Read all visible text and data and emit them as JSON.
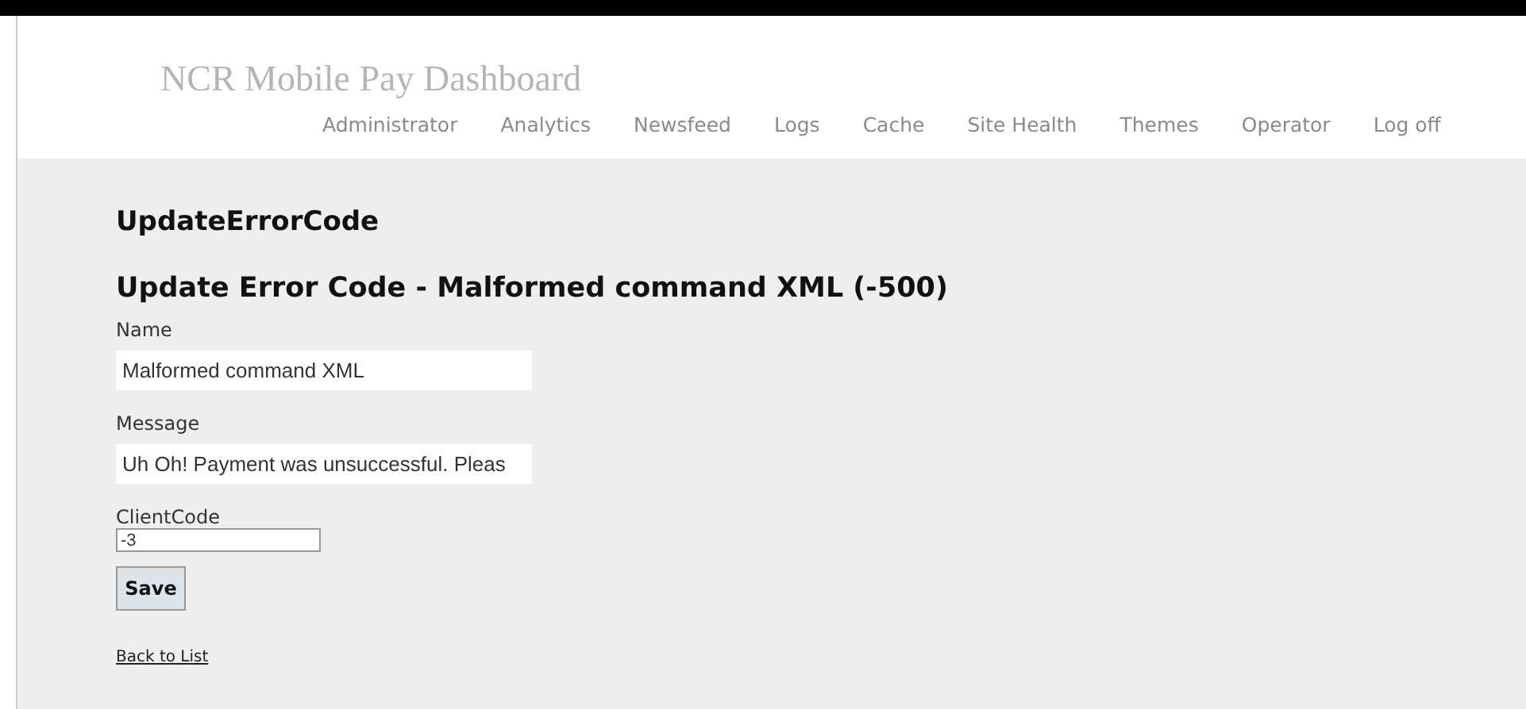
{
  "header": {
    "title": "NCR Mobile Pay Dashboard"
  },
  "nav": [
    {
      "label": "Administrator"
    },
    {
      "label": "Analytics"
    },
    {
      "label": "Newsfeed"
    },
    {
      "label": "Logs"
    },
    {
      "label": "Cache"
    },
    {
      "label": "Site Health"
    },
    {
      "label": "Themes"
    },
    {
      "label": "Operator"
    },
    {
      "label": "Log off"
    }
  ],
  "page_title": "UpdateErrorCode",
  "form": {
    "heading": "Update Error Code - Malformed command XML (-500)",
    "fields": [
      {
        "label": "Name",
        "value": "Malformed command XML",
        "kind": "wide"
      },
      {
        "label": "Message",
        "value": "Uh Oh! Payment was unsuccessful. Pleas",
        "kind": "wide"
      },
      {
        "label": "ClientCode",
        "value": "-3",
        "kind": "small"
      }
    ],
    "submit": "Save"
  },
  "back_link": "Back to List"
}
